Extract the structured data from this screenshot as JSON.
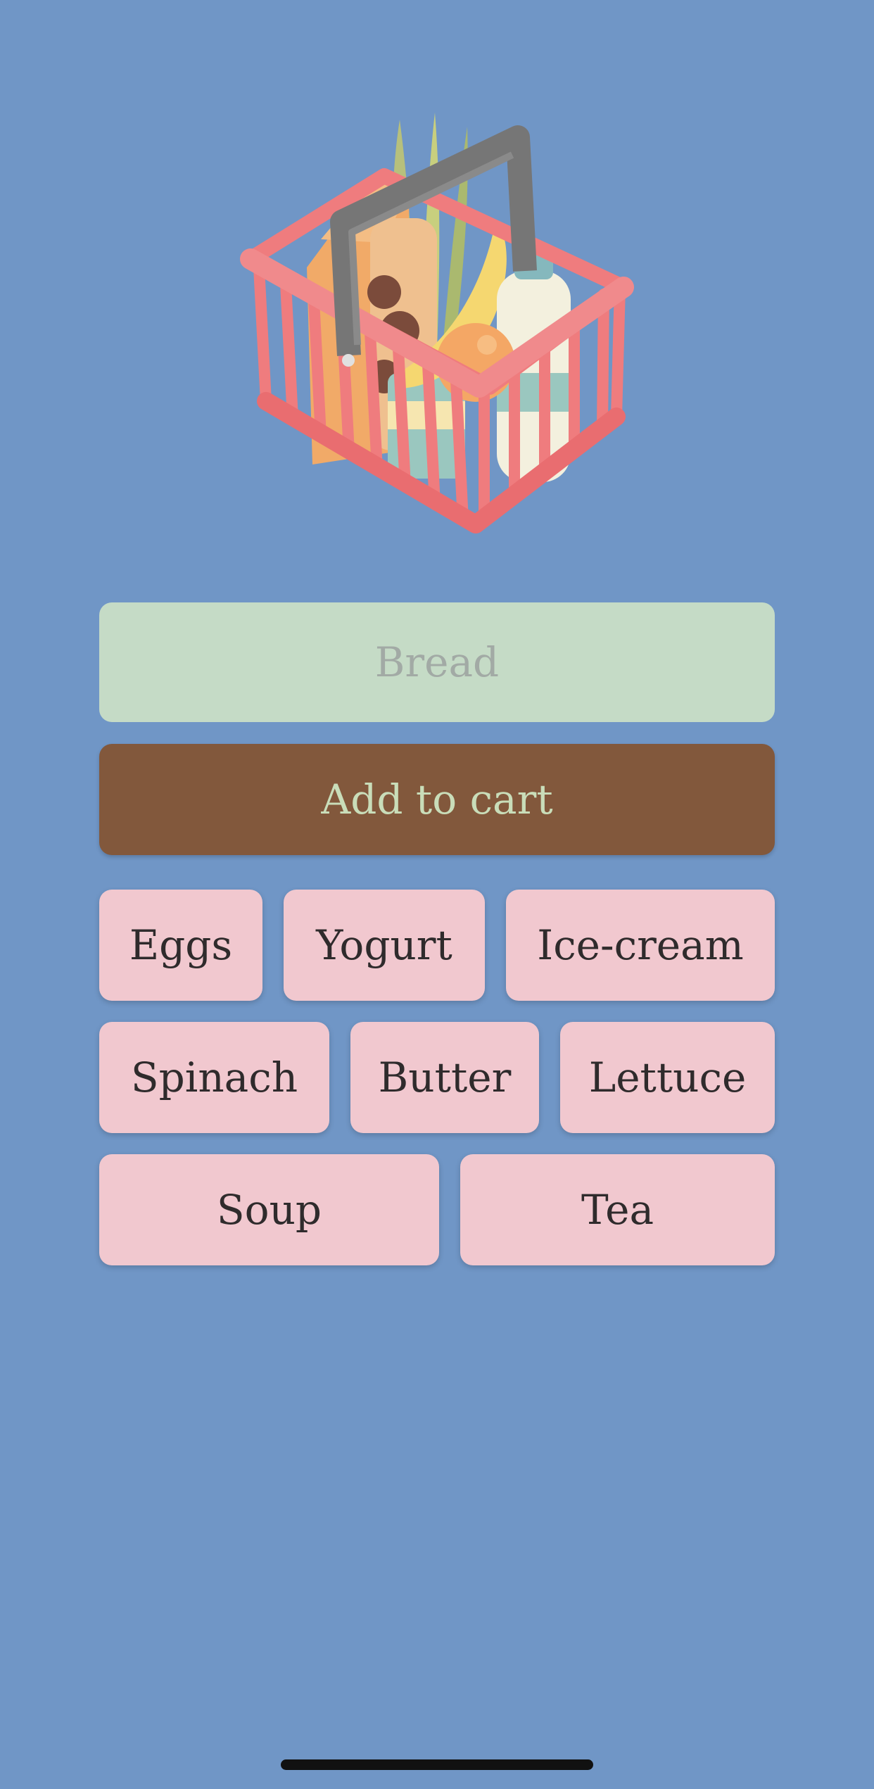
{
  "hero": {
    "illustration": "grocery-basket"
  },
  "input": {
    "placeholder": "Bread",
    "value": ""
  },
  "add_button": {
    "label": "Add to cart"
  },
  "suggestions": [
    [
      "Eggs",
      "Yogurt",
      "Ice-cream"
    ],
    [
      "Spinach",
      "Butter",
      "Lettuce"
    ],
    [
      "Soup",
      "Tea"
    ]
  ],
  "colors": {
    "background": "#7096c6",
    "input": "#c5dbc6",
    "button": "#82583c",
    "chip": "#f1c8cf"
  }
}
